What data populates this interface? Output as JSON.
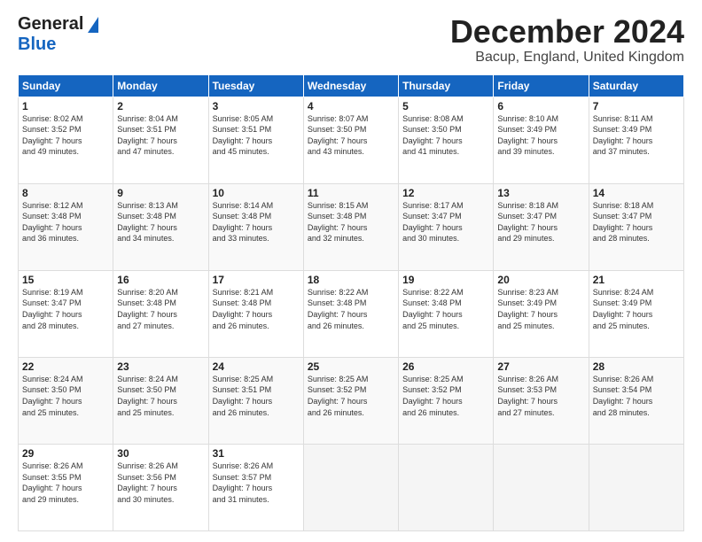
{
  "logo": {
    "general": "General",
    "blue": "Blue"
  },
  "title": {
    "month": "December 2024",
    "location": "Bacup, England, United Kingdom"
  },
  "calendar": {
    "headers": [
      "Sunday",
      "Monday",
      "Tuesday",
      "Wednesday",
      "Thursday",
      "Friday",
      "Saturday"
    ],
    "weeks": [
      [
        {
          "day": "1",
          "info": "Sunrise: 8:02 AM\nSunset: 3:52 PM\nDaylight: 7 hours\nand 49 minutes."
        },
        {
          "day": "2",
          "info": "Sunrise: 8:04 AM\nSunset: 3:51 PM\nDaylight: 7 hours\nand 47 minutes."
        },
        {
          "day": "3",
          "info": "Sunrise: 8:05 AM\nSunset: 3:51 PM\nDaylight: 7 hours\nand 45 minutes."
        },
        {
          "day": "4",
          "info": "Sunrise: 8:07 AM\nSunset: 3:50 PM\nDaylight: 7 hours\nand 43 minutes."
        },
        {
          "day": "5",
          "info": "Sunrise: 8:08 AM\nSunset: 3:50 PM\nDaylight: 7 hours\nand 41 minutes."
        },
        {
          "day": "6",
          "info": "Sunrise: 8:10 AM\nSunset: 3:49 PM\nDaylight: 7 hours\nand 39 minutes."
        },
        {
          "day": "7",
          "info": "Sunrise: 8:11 AM\nSunset: 3:49 PM\nDaylight: 7 hours\nand 37 minutes."
        }
      ],
      [
        {
          "day": "8",
          "info": "Sunrise: 8:12 AM\nSunset: 3:48 PM\nDaylight: 7 hours\nand 36 minutes."
        },
        {
          "day": "9",
          "info": "Sunrise: 8:13 AM\nSunset: 3:48 PM\nDaylight: 7 hours\nand 34 minutes."
        },
        {
          "day": "10",
          "info": "Sunrise: 8:14 AM\nSunset: 3:48 PM\nDaylight: 7 hours\nand 33 minutes."
        },
        {
          "day": "11",
          "info": "Sunrise: 8:15 AM\nSunset: 3:48 PM\nDaylight: 7 hours\nand 32 minutes."
        },
        {
          "day": "12",
          "info": "Sunrise: 8:17 AM\nSunset: 3:47 PM\nDaylight: 7 hours\nand 30 minutes."
        },
        {
          "day": "13",
          "info": "Sunrise: 8:18 AM\nSunset: 3:47 PM\nDaylight: 7 hours\nand 29 minutes."
        },
        {
          "day": "14",
          "info": "Sunrise: 8:18 AM\nSunset: 3:47 PM\nDaylight: 7 hours\nand 28 minutes."
        }
      ],
      [
        {
          "day": "15",
          "info": "Sunrise: 8:19 AM\nSunset: 3:47 PM\nDaylight: 7 hours\nand 28 minutes."
        },
        {
          "day": "16",
          "info": "Sunrise: 8:20 AM\nSunset: 3:48 PM\nDaylight: 7 hours\nand 27 minutes."
        },
        {
          "day": "17",
          "info": "Sunrise: 8:21 AM\nSunset: 3:48 PM\nDaylight: 7 hours\nand 26 minutes."
        },
        {
          "day": "18",
          "info": "Sunrise: 8:22 AM\nSunset: 3:48 PM\nDaylight: 7 hours\nand 26 minutes."
        },
        {
          "day": "19",
          "info": "Sunrise: 8:22 AM\nSunset: 3:48 PM\nDaylight: 7 hours\nand 25 minutes."
        },
        {
          "day": "20",
          "info": "Sunrise: 8:23 AM\nSunset: 3:49 PM\nDaylight: 7 hours\nand 25 minutes."
        },
        {
          "day": "21",
          "info": "Sunrise: 8:24 AM\nSunset: 3:49 PM\nDaylight: 7 hours\nand 25 minutes."
        }
      ],
      [
        {
          "day": "22",
          "info": "Sunrise: 8:24 AM\nSunset: 3:50 PM\nDaylight: 7 hours\nand 25 minutes."
        },
        {
          "day": "23",
          "info": "Sunrise: 8:24 AM\nSunset: 3:50 PM\nDaylight: 7 hours\nand 25 minutes."
        },
        {
          "day": "24",
          "info": "Sunrise: 8:25 AM\nSunset: 3:51 PM\nDaylight: 7 hours\nand 26 minutes."
        },
        {
          "day": "25",
          "info": "Sunrise: 8:25 AM\nSunset: 3:52 PM\nDaylight: 7 hours\nand 26 minutes."
        },
        {
          "day": "26",
          "info": "Sunrise: 8:25 AM\nSunset: 3:52 PM\nDaylight: 7 hours\nand 26 minutes."
        },
        {
          "day": "27",
          "info": "Sunrise: 8:26 AM\nSunset: 3:53 PM\nDaylight: 7 hours\nand 27 minutes."
        },
        {
          "day": "28",
          "info": "Sunrise: 8:26 AM\nSunset: 3:54 PM\nDaylight: 7 hours\nand 28 minutes."
        }
      ],
      [
        {
          "day": "29",
          "info": "Sunrise: 8:26 AM\nSunset: 3:55 PM\nDaylight: 7 hours\nand 29 minutes."
        },
        {
          "day": "30",
          "info": "Sunrise: 8:26 AM\nSunset: 3:56 PM\nDaylight: 7 hours\nand 30 minutes."
        },
        {
          "day": "31",
          "info": "Sunrise: 8:26 AM\nSunset: 3:57 PM\nDaylight: 7 hours\nand 31 minutes."
        },
        {
          "day": "",
          "info": ""
        },
        {
          "day": "",
          "info": ""
        },
        {
          "day": "",
          "info": ""
        },
        {
          "day": "",
          "info": ""
        }
      ]
    ]
  }
}
